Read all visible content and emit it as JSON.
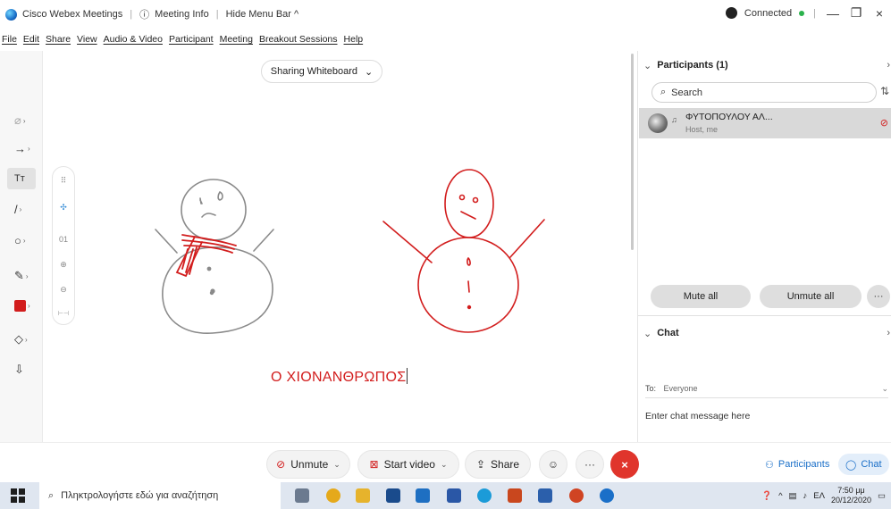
{
  "titlebar": {
    "app_title": "Cisco Webex Meetings",
    "meeting_info": "Meeting Info",
    "hide_menu": "Hide Menu Bar ^",
    "connection": "Connected",
    "minimize": "—",
    "restore": "❐",
    "close": "×"
  },
  "menu": [
    "File",
    "Edit",
    "Share",
    "View",
    "Audio & Video",
    "Participant",
    "Meeting",
    "Breakout Sessions",
    "Help"
  ],
  "sharing": {
    "label": "Sharing Whiteboard",
    "caret": "⌄"
  },
  "tools": {
    "pointer": "⌀",
    "arrow": "→",
    "text": "Tт",
    "line": "/",
    "shape": "○",
    "pen": "✎",
    "eraser": "◇",
    "save": "⇩",
    "sub": "›"
  },
  "minirail": {
    "grid": "⠿",
    "pan": "✣",
    "zoom_level": "01",
    "zoom_in": "⊕",
    "zoom_out": "⊖",
    "fit": "⊢⊣"
  },
  "whiteboard": {
    "text": "Ο ΧΙΟΝΑΝΘΡΩΠΟΣ"
  },
  "participants": {
    "title": "Participants (1)",
    "search_placeholder": "Search",
    "list": [
      {
        "name": "ΦΥΤΟΠΟΥΛΟΥ ΑΛ...",
        "role": "Host, me"
      }
    ],
    "mute_all": "Mute all",
    "unmute_all": "Unmute all",
    "more": "···"
  },
  "chat": {
    "title": "Chat",
    "to_label": "To:",
    "to_value": "Everyone",
    "input_placeholder": "Enter chat message here"
  },
  "controls": {
    "unmute": "Unmute",
    "start_video": "Start video",
    "share": "Share",
    "more": "···",
    "end": "×",
    "participants_tab": "Participants",
    "chat_tab": "Chat"
  },
  "taskbar": {
    "search_placeholder": "Πληκτρολογήστε εδώ για αναζήτηση",
    "lang": "ΕΛ",
    "time": "7:50 μμ",
    "date": "20/12/2020"
  },
  "colors": {
    "ink_red": "#d21d1d",
    "ink_gray": "#8a8a8a",
    "accent_blue": "#1a6fc8",
    "end_red": "#e0352c"
  }
}
